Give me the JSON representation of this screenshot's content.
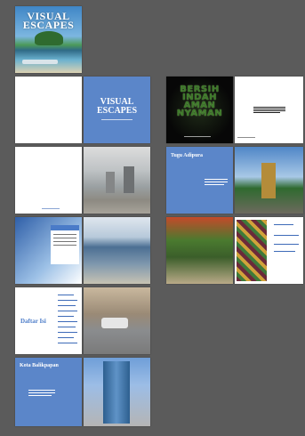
{
  "pages": {
    "cover": {
      "title": "VISUAL ESCAPES"
    },
    "title_page": {
      "title": "VISUAL ESCAPES"
    },
    "bersih": {
      "text": "BERSIH INDAH AMAN NYAMAN"
    },
    "tugu": {
      "heading": "Tugu Adipura"
    },
    "toc": {
      "heading": "Daftar Isi"
    },
    "kota": {
      "heading": "Kota Balikpapan"
    }
  }
}
